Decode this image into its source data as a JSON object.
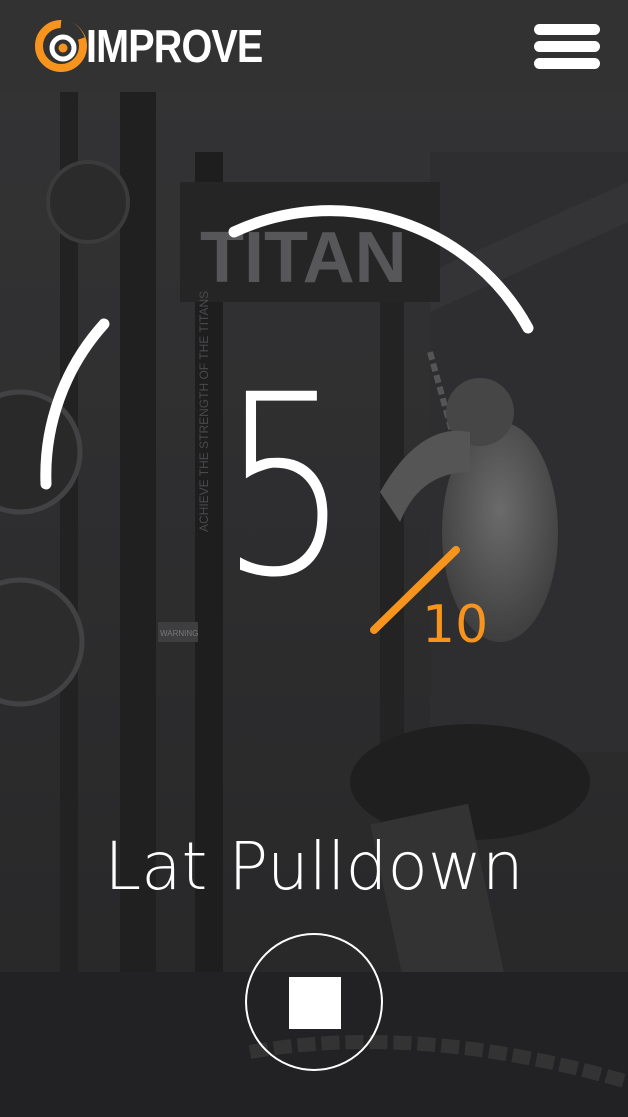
{
  "header": {
    "brand": "IMPROVE",
    "accent_color": "#f7941d",
    "logo_icon": "target-logo-icon",
    "menu_icon": "hamburger-menu-icon"
  },
  "background": {
    "rack_text": "TITAN",
    "rack_side_text": "ACHIEVE THE STRENGTH OF THE TITANS",
    "warning_label": "WARNING"
  },
  "workout": {
    "current_rep": "5",
    "total_reps": "10",
    "progress_fraction": 0.5,
    "exercise_name": "Lat Pulldown",
    "stop_icon": "stop-icon"
  }
}
